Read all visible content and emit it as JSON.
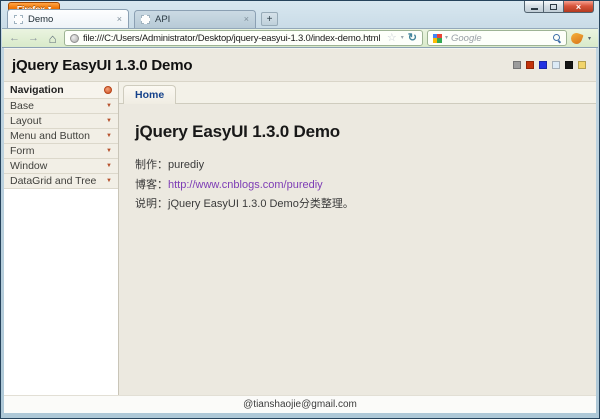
{
  "browser": {
    "firefox_button_label": "Firefox",
    "tabs": [
      {
        "label": "Demo"
      },
      {
        "label": "API"
      }
    ],
    "new_tab_label": "+",
    "url": "file:///C:/Users/Administrator/Desktop/jquery-easyui-1.3.0/index-demo.html",
    "search_placeholder": "Google",
    "google_logo_colors": [
      "#4285f4",
      "#ea4335",
      "#fbbc05",
      "#34a853"
    ]
  },
  "icons": {
    "firefox_dropdown": "▾",
    "close_window": "×",
    "close_tab": "×",
    "back": "←",
    "forward": "→",
    "home": "⌂",
    "star": "☆",
    "dropdown": "▾",
    "reload": "↻",
    "accordion_arrow": "▼"
  },
  "page": {
    "header": {
      "title": "jQuery EasyUI 1.3.0 Demo",
      "theme_colors": [
        "#9c9c9c",
        "#c23209",
        "#2231e2",
        "#dceaf6",
        "#151515",
        "#f2d46a"
      ]
    },
    "sidebar": {
      "title": "Navigation",
      "items": [
        {
          "label": "Base"
        },
        {
          "label": "Layout"
        },
        {
          "label": "Menu and Button"
        },
        {
          "label": "Form"
        },
        {
          "label": "Window"
        },
        {
          "label": "DataGrid and Tree"
        }
      ]
    },
    "main": {
      "tab_label": "Home",
      "heading": "jQuery EasyUI 1.3.0 Demo",
      "author_label": "制作：",
      "author_value": "purediy",
      "blog_label": "博客：",
      "blog_link": "http://www.cnblogs.com/purediy",
      "desc_label": "说明：",
      "desc_value": "jQuery EasyUI 1.3.0 Demo分类整理。"
    },
    "footer": {
      "text": "@tianshaojie@gmail.com"
    }
  }
}
